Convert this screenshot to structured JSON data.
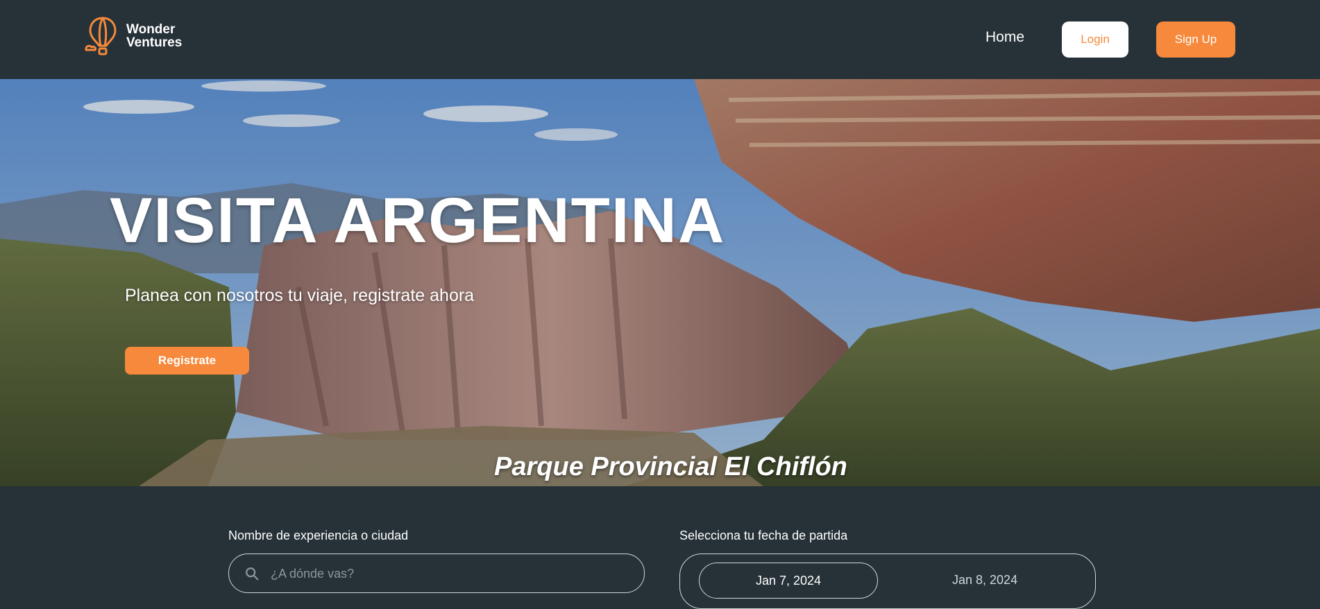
{
  "brand": {
    "line1": "Wonder",
    "line2": "Ventures",
    "accent": "#f6893b"
  },
  "nav": {
    "home": "Home",
    "login": "Login",
    "signup": "Sign Up"
  },
  "hero": {
    "title": "VISITA ARGENTINA",
    "subtitle": "Planea con nosotros tu viaje, registrate ahora",
    "cta": "Registrate",
    "caption": "Parque Provincial El Chiflón"
  },
  "search": {
    "destination_label": "Nombre de experiencia o ciudad",
    "destination_placeholder": "¿A dónde vas?",
    "date_label": "Selecciona tu fecha de partida",
    "date_start": "Jan 7, 2024",
    "date_end": "Jan 8, 2024"
  },
  "colors": {
    "background": "#263238",
    "button_white": "#ffffff"
  }
}
